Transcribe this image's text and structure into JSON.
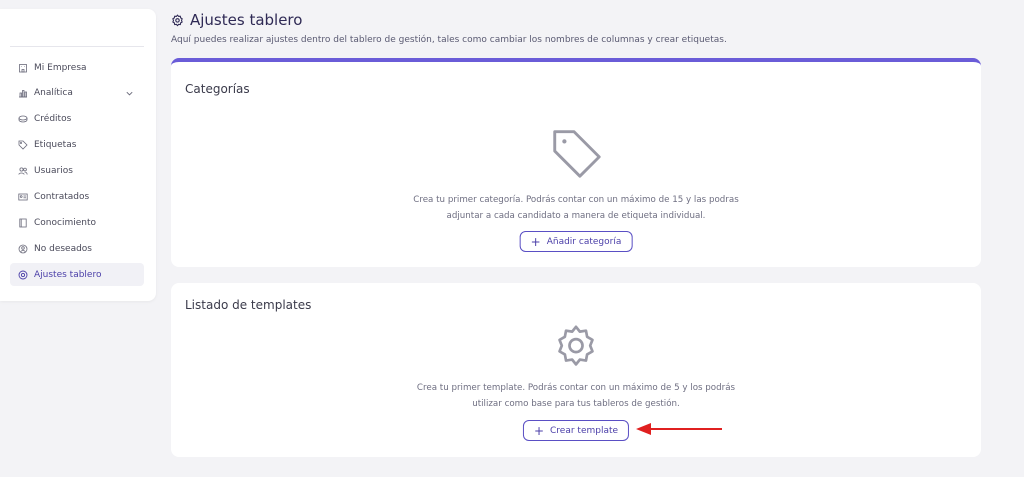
{
  "sidebar": {
    "items": [
      {
        "label": "Mi Empresa",
        "icon": "building-icon"
      },
      {
        "label": "Analítica",
        "icon": "bar-chart-icon"
      },
      {
        "label": "Créditos",
        "icon": "coins-icon"
      },
      {
        "label": "Etiquetas",
        "icon": "tag-icon"
      },
      {
        "label": "Usuarios",
        "icon": "users-icon"
      },
      {
        "label": "Contratados",
        "icon": "id-card-icon"
      },
      {
        "label": "Conocimiento",
        "icon": "book-icon"
      },
      {
        "label": "No deseados",
        "icon": "blocked-user-icon"
      },
      {
        "label": "Ajustes tablero",
        "icon": "settings-icon",
        "active": true
      }
    ]
  },
  "header": {
    "title": "Ajustes tablero",
    "subtitle": "Aquí puedes realizar ajustes dentro del tablero de gestión, tales como cambiar los nombres de columnas y crear etiquetas."
  },
  "categories": {
    "title": "Categorías",
    "empty_line1": "Crea tu primer categoría. Podrás contar con un máximo de 15 y las podras",
    "empty_line2": "adjuntar a cada candidato a manera de etiqueta individual.",
    "button": "Añadir categoría"
  },
  "templates": {
    "title": "Listado de templates",
    "empty_line1": "Crea tu primer template. Podrás contar con un máximo de 5 y los podrás",
    "empty_line2": "utilizar como base para tus tableros de gestión.",
    "button": "Crear template"
  },
  "colors": {
    "accent": "#6a5cd8",
    "arrow": "#e02020"
  }
}
